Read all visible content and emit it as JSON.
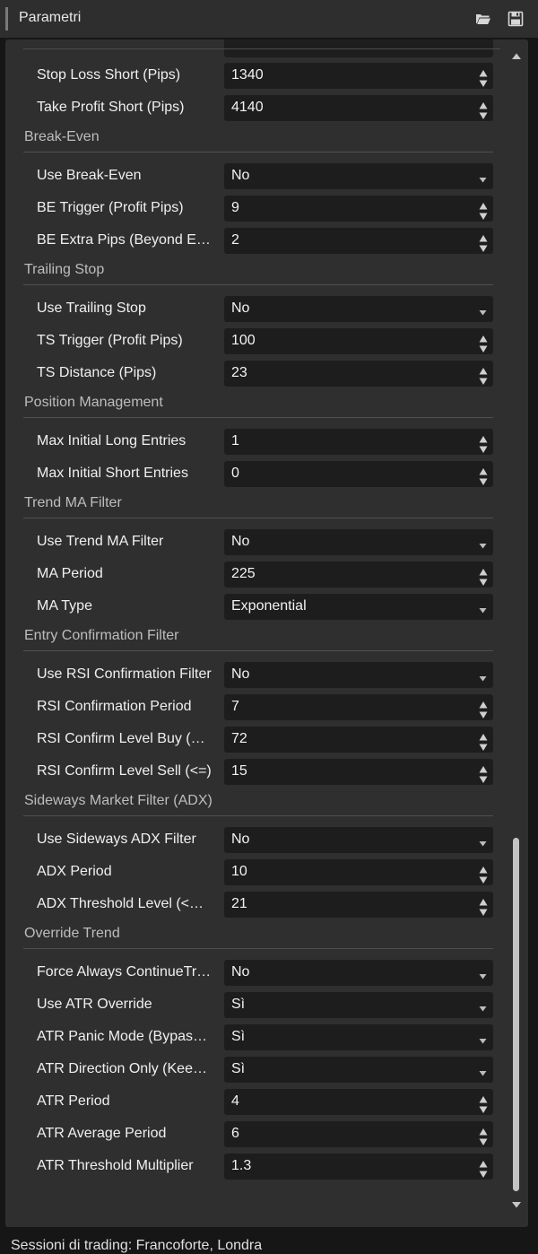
{
  "header": {
    "title": "Parametri",
    "icons": [
      "folder-open-icon",
      "save-icon"
    ]
  },
  "sections": [
    {
      "id": "risk",
      "title": "",
      "rows": [
        {
          "label": "Stop Loss Short (Pips)",
          "value": "1340",
          "control": "spinner"
        },
        {
          "label": "Take Profit Short (Pips)",
          "value": "4140",
          "control": "spinner"
        }
      ]
    },
    {
      "id": "break-even",
      "title": "Break-Even",
      "rows": [
        {
          "label": "Use Break-Even",
          "value": "No",
          "control": "dropdown"
        },
        {
          "label": "BE Trigger (Profit Pips)",
          "value": "9",
          "control": "spinner"
        },
        {
          "label": "BE Extra Pips (Beyond E…",
          "value": "2",
          "control": "spinner"
        }
      ]
    },
    {
      "id": "trailing-stop",
      "title": "Trailing Stop",
      "rows": [
        {
          "label": "Use Trailing Stop",
          "value": "No",
          "control": "dropdown"
        },
        {
          "label": "TS Trigger (Profit Pips)",
          "value": "100",
          "control": "spinner"
        },
        {
          "label": "TS Distance (Pips)",
          "value": "23",
          "control": "spinner"
        }
      ]
    },
    {
      "id": "position-management",
      "title": "Position Management",
      "rows": [
        {
          "label": "Max Initial Long Entries",
          "value": "1",
          "control": "spinner"
        },
        {
          "label": "Max Initial Short Entries",
          "value": "0",
          "control": "spinner"
        }
      ]
    },
    {
      "id": "trend-ma-filter",
      "title": "Trend MA Filter",
      "rows": [
        {
          "label": "Use Trend MA Filter",
          "value": "No",
          "control": "dropdown"
        },
        {
          "label": "MA Period",
          "value": "225",
          "control": "spinner"
        },
        {
          "label": "MA Type",
          "value": "Exponential",
          "control": "dropdown"
        }
      ]
    },
    {
      "id": "entry-confirmation-filter",
      "title": "Entry Confirmation Filter",
      "rows": [
        {
          "label": "Use RSI Confirmation Filter",
          "value": "No",
          "control": "dropdown"
        },
        {
          "label": "RSI Confirmation Period",
          "value": "7",
          "control": "spinner"
        },
        {
          "label": "RSI Confirm Level Buy (…",
          "value": "72",
          "control": "spinner"
        },
        {
          "label": "RSI Confirm Level Sell (<=)",
          "value": "15",
          "control": "spinner"
        }
      ]
    },
    {
      "id": "sideways-market-filter",
      "title": "Sideways Market Filter (ADX)",
      "rows": [
        {
          "label": "Use Sideways ADX Filter",
          "value": "No",
          "control": "dropdown"
        },
        {
          "label": "ADX Period",
          "value": "10",
          "control": "spinner"
        },
        {
          "label": "ADX Threshold Level (<…",
          "value": "21",
          "control": "spinner"
        }
      ]
    },
    {
      "id": "override-trend",
      "title": "Override Trend",
      "rows": [
        {
          "label": "Force Always ContinueTr…",
          "value": "No",
          "control": "dropdown"
        },
        {
          "label": "Use ATR Override",
          "value": "Sì",
          "control": "dropdown"
        },
        {
          "label": "ATR Panic Mode (Bypas…",
          "value": "Sì",
          "control": "dropdown"
        },
        {
          "label": "ATR Direction Only (Kee…",
          "value": "Sì",
          "control": "dropdown"
        },
        {
          "label": "ATR Period",
          "value": "4",
          "control": "spinner"
        },
        {
          "label": "ATR Average Period",
          "value": "6",
          "control": "spinner"
        },
        {
          "label": "ATR Threshold Multiplier",
          "value": "1.3",
          "control": "spinner"
        }
      ]
    }
  ],
  "footer": {
    "text": "Sessioni di trading: Francoforte, Londra"
  },
  "colors": {
    "panel_bg": "#2f2f2f",
    "input_bg": "#1d1d1d",
    "header_bg": "#2e2e2e",
    "section_text": "#bdbdbd",
    "label_text": "#f0f0f0"
  }
}
